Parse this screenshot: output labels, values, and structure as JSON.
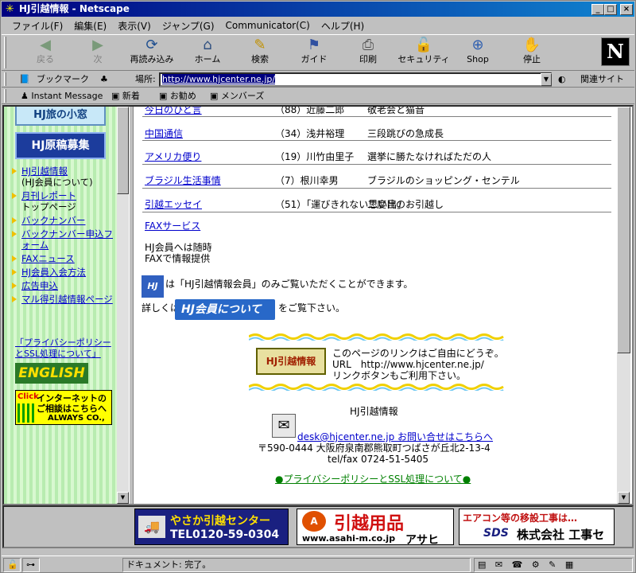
{
  "window": {
    "title": "HJ引越情報 - Netscape"
  },
  "menu": [
    "ファイル(F)",
    "編集(E)",
    "表示(V)",
    "ジャンプ(G)",
    "Communicator(C)",
    "ヘルプ(H)"
  ],
  "toolbar": {
    "back": "戻る",
    "forward": "次",
    "reload": "再読み込み",
    "home": "ホーム",
    "search": "検索",
    "guide": "ガイド",
    "print": "印刷",
    "security": "セキュリティ",
    "shop": "Shop",
    "stop": "停止"
  },
  "location": {
    "bookmark_label": "ブックマーク",
    "location_label": "場所:",
    "url": "http://www.hjcenter.ne.jp/",
    "related_label": "関連サイト"
  },
  "personal_bar": {
    "instant_message": "Instant Message",
    "new": "新着",
    "recommend": "お勧め",
    "members": "メンバーズ"
  },
  "left_nav": {
    "banner_top": "HJ旅の小窓",
    "banner_boshu": "HJ原稿募集",
    "items": [
      {
        "label": "HJ引越情報",
        "sub": "(HJ会員について)"
      },
      {
        "label": "月刊レポート",
        "sub": "トップページ"
      },
      {
        "label": "バックナンバー",
        "sub": ""
      },
      {
        "label": "バックナンバー申込フォーム",
        "sub": ""
      },
      {
        "label": "FAXニュース",
        "sub": ""
      },
      {
        "label": "HJ会員入会方法",
        "sub": ""
      },
      {
        "label": "広告申込",
        "sub": ""
      },
      {
        "label": "マル得引越情報ページ",
        "sub": ""
      }
    ],
    "privacy": "「プライバシーポリシーとSSL処理について」",
    "english": "ENGLISH",
    "click_banner": {
      "click": "Click",
      "line1": "インターネットの",
      "line2": "ご相談はこちらへ",
      "line3": "ALWAYS CO.,"
    }
  },
  "main": {
    "rows": [
      {
        "link": "今日のひと言",
        "num": "（88）近藤二郎",
        "desc": "敬老会と猫音"
      },
      {
        "link": "中国通信",
        "num": "（34）浅井裕理",
        "desc": "三段跳びの急成長"
      },
      {
        "link": "アメリカ便り",
        "num": "（19）川竹由里子",
        "desc": "選挙に勝たなければただの人"
      },
      {
        "link": "ブラジル生活事情",
        "num": "（7）根川幸男",
        "desc": "ブラジルのショッピング・センテル"
      },
      {
        "link": "引越エッセイ",
        "num": "（51）「運びきれない思い出」",
        "desc": "二度目のお引越し"
      }
    ],
    "fax_link": "FAXサービス",
    "fax_note1": "HJ会員へは随時",
    "fax_note2": "FAXで情報提供",
    "hj_icon": "HJ",
    "members_note": "は「HJ引越情報会員」のみご覧いただくことができます。",
    "details_prefix": "詳しくは",
    "hj_button": "HJ会員について",
    "details_suffix": "をご覧下さい。",
    "link_banner": "HJ引越情報",
    "link_text1": "このページのリンクはご自由にどうぞ。",
    "link_text2": "URL　http://www.hjcenter.ne.jp/",
    "link_text3": "リンクボタンもご利用下さい。",
    "org_name": "HJ引越情報",
    "email": "desk@hjcenter.ne.jp お問い合せはこちらへ",
    "address": "〒590-0444 大阪府泉南郡熊取町つばさが丘北2-13-4",
    "telfax": "tel/fax 0724-51-5405",
    "privacy_link": "●プライバシーポリシーとSSL処理について●"
  },
  "ads": {
    "ad1_line1": "やさか引越センター",
    "ad1_line2": "TEL0120-59-0304",
    "ad2_line1": "引越用品",
    "ad2_url": "www.asahi-m.co.jp",
    "ad2_brand": "アサヒ",
    "ad3_line1": "エアコン等の移設工事は…",
    "ad3_logo": "SDS",
    "ad3_line2": "株式会社 工事センター"
  },
  "status": {
    "text": "ドキュメント: 完了。"
  },
  "colors": {
    "title_bar": "#000080",
    "link": "#0000cc",
    "left_frame_bg": "#c8f0c0",
    "wave": "#f0d000"
  }
}
